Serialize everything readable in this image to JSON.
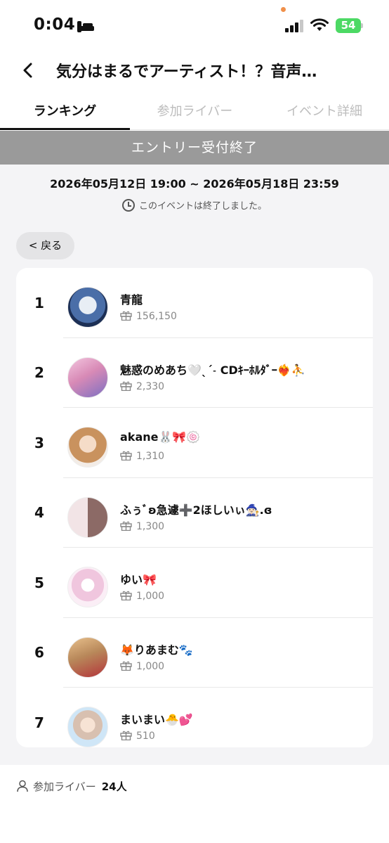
{
  "status_bar": {
    "time": "0:04",
    "battery": "54"
  },
  "header": {
    "title": "気分はまるでアーティスト！？音声…"
  },
  "tabs": [
    {
      "label": "ランキング",
      "active": true
    },
    {
      "label": "参加ライバー",
      "active": false
    },
    {
      "label": "イベント詳細",
      "active": false
    }
  ],
  "banner": "エントリー受付終了",
  "period": "2026年05月12日 19:00 ~ 2026年05月18日 23:59",
  "ended_note": "このイベントは終了しました。",
  "back_button": "< 戻る",
  "ranking": [
    {
      "rank": "1",
      "name": "青龍",
      "gifts": "156,150",
      "avatar_color": "#2b4a7a"
    },
    {
      "rank": "2",
      "name": "魅惑のめあち🤍ˎˊ˗ CDｷｰﾎﾙﾀﾞｰ❤️‍🔥⛹️",
      "gifts": "2,330",
      "avatar_color": "#d88ab6"
    },
    {
      "rank": "3",
      "name": "akane🐰🎀🍥",
      "gifts": "1,310",
      "avatar_color": "#d9b48f"
    },
    {
      "rank": "4",
      "name": "ふぅﾞʚ急遽➕2ほしいぃ🧙🏻‍♀️.ɞ",
      "gifts": "1,300",
      "avatar_color": "#c99ca4"
    },
    {
      "rank": "5",
      "name": "ゆい🎀",
      "gifts": "1,000",
      "avatar_color": "#eab8d6"
    },
    {
      "rank": "6",
      "name": "🦊りあまむ🐾",
      "gifts": "1,000",
      "avatar_color": "#b8885a"
    },
    {
      "rank": "7",
      "name": "まいまい🐣💕",
      "gifts": "510",
      "avatar_color": "#b8d8f0"
    }
  ],
  "footer": {
    "label": "参加ライバー",
    "count": "24人"
  }
}
